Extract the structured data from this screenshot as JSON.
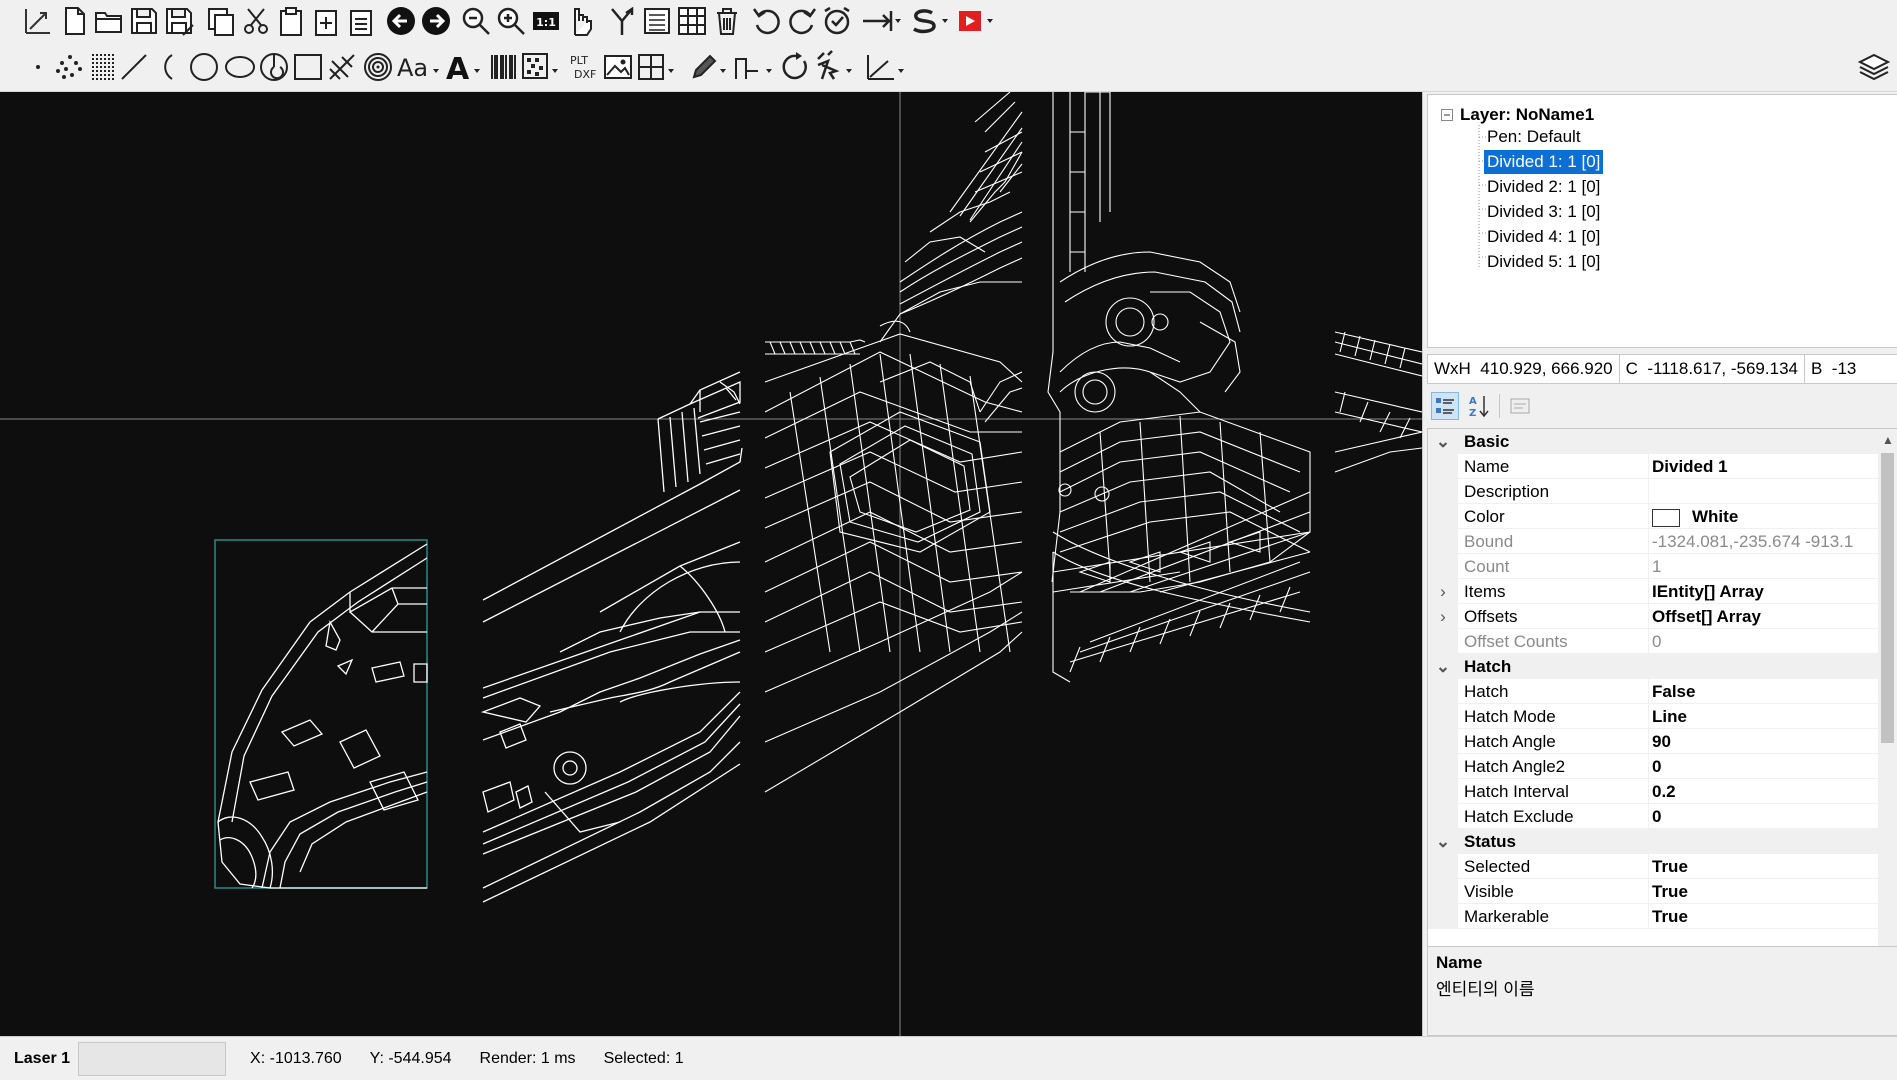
{
  "toolbar1": {
    "icons": [
      "drawing-area-icon",
      "new-file-icon",
      "open-file-icon",
      "save-icon",
      "save-as-icon",
      "copy-icon",
      "cut-icon",
      "paste-icon",
      "paste-special-icon",
      "clipboard-icon",
      "arrow-left-icon",
      "arrow-right-icon",
      "zoom-out-icon",
      "zoom-in-icon",
      "zoom-1to1-icon",
      "pan-hand-icon",
      "fork-icon",
      "list-icon",
      "table-icon",
      "delete-icon",
      "rotate-ccw-icon",
      "rotate-cw-icon",
      "alarm-icon",
      "arrow-line-icon",
      "path-s-icon",
      "record-icon"
    ],
    "zoom_1to1_label": "1:1"
  },
  "toolbar2": {
    "icons": [
      "point-icon",
      "scatter-icon",
      "grid-dots-icon",
      "line-icon",
      "arc-icon",
      "circle-icon",
      "ellipse-icon",
      "spiral-icon",
      "rectangle-icon",
      "trepan-icon",
      "donut-icon",
      "text-aa-icon",
      "text-a-icon",
      "barcode-icon",
      "matrix-code-icon",
      "plt-dxf-icon",
      "image-icon",
      "array-grid-icon",
      "pen-icon",
      "ramp-icon",
      "rotate-icon",
      "pointer-plus-icon",
      "axis-icon",
      "layers-icon"
    ],
    "aa_label": "Aa",
    "a_label": "A",
    "plt_label": "PLT",
    "dxf_label": "DXF"
  },
  "tree": {
    "layer": "Layer: NoName1",
    "items": [
      "Pen: Default",
      "Divided 1: 1 [0]",
      "Divided 2: 1 [0]",
      "Divided 3: 1 [0]",
      "Divided 4: 1 [0]",
      "Divided 5: 1 [0]"
    ],
    "selected_index": 1
  },
  "infobar": {
    "wxh_label": "WxH",
    "wxh_value": "410.929, 666.920",
    "c_label": "C",
    "c_value": "-1118.617, -569.134",
    "b_label": "B",
    "b_value": "-13"
  },
  "propertygrid": {
    "basic": {
      "title": "Basic",
      "rows": [
        {
          "name": "Name",
          "value": "Divided 1"
        },
        {
          "name": "Description",
          "value": ""
        },
        {
          "name": "Color",
          "value": "White"
        },
        {
          "name": "Bound",
          "value": "-1324.081,-235.674 -913.1"
        },
        {
          "name": "Count",
          "value": "1"
        },
        {
          "name": "Items",
          "value": "IEntity[] Array"
        },
        {
          "name": "Offsets",
          "value": "Offset[] Array"
        },
        {
          "name": "Offset Counts",
          "value": "0"
        }
      ]
    },
    "hatch": {
      "title": "Hatch",
      "rows": [
        {
          "name": "Hatch",
          "value": "False"
        },
        {
          "name": "Hatch Mode",
          "value": "Line"
        },
        {
          "name": "Hatch Angle",
          "value": "90"
        },
        {
          "name": "Hatch Angle2",
          "value": "0"
        },
        {
          "name": "Hatch Interval",
          "value": "0.2"
        },
        {
          "name": "Hatch Exclude",
          "value": "0"
        }
      ]
    },
    "status": {
      "title": "Status",
      "rows": [
        {
          "name": "Selected",
          "value": "True"
        },
        {
          "name": "Visible",
          "value": "True"
        },
        {
          "name": "Markerable",
          "value": "True"
        }
      ]
    }
  },
  "description": {
    "title": "Name",
    "text": "엔티티의 이름"
  },
  "statusbar": {
    "laser": "Laser 1",
    "x": "X: -1013.760",
    "y": "Y: -544.954",
    "render": "Render: 1 ms",
    "selected": "Selected: 1"
  },
  "colors": {
    "canvas_bg": "#0e0e0e",
    "wireframe": "#ffffff",
    "selection_box": "#2a8a8a",
    "crosshair": "#8a8a8a",
    "tree_selected": "#0b6fd6",
    "record_red": "#e02020"
  }
}
